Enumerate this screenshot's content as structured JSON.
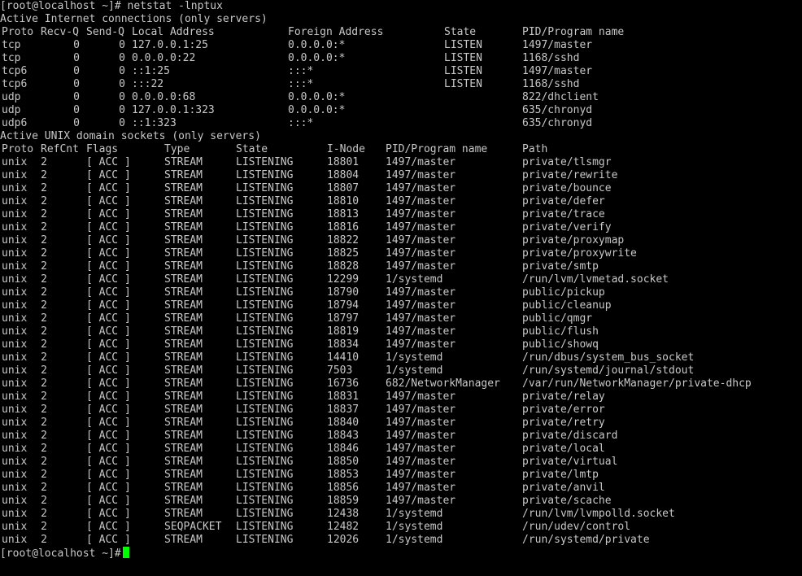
{
  "terminal": {
    "command_line": "[root@localhost ~]# netstat -lnptux",
    "inet_header": "Active Internet connections (only servers)",
    "inet_columns": [
      "Proto",
      "Recv-Q",
      "Send-Q",
      "Local Address",
      "Foreign Address",
      "State",
      "PID/Program name"
    ],
    "inet_rows": [
      [
        "tcp",
        "0",
        "0",
        "127.0.0.1:25",
        "0.0.0.0:*",
        "LISTEN",
        "1497/master"
      ],
      [
        "tcp",
        "0",
        "0",
        "0.0.0.0:22",
        "0.0.0.0:*",
        "LISTEN",
        "1168/sshd"
      ],
      [
        "tcp6",
        "0",
        "0",
        "::1:25",
        ":::*",
        "LISTEN",
        "1497/master"
      ],
      [
        "tcp6",
        "0",
        "0",
        ":::22",
        ":::*",
        "LISTEN",
        "1168/sshd"
      ],
      [
        "udp",
        "0",
        "0",
        "0.0.0.0:68",
        "0.0.0.0:*",
        "",
        "822/dhclient"
      ],
      [
        "udp",
        "0",
        "0",
        "127.0.0.1:323",
        "0.0.0.0:*",
        "",
        "635/chronyd"
      ],
      [
        "udp6",
        "0",
        "0",
        "::1:323",
        ":::*",
        "",
        "635/chronyd"
      ]
    ],
    "unix_header": "Active UNIX domain sockets (only servers)",
    "unix_columns": [
      "Proto",
      "RefCnt",
      "Flags",
      "Type",
      "State",
      "I-Node",
      "PID/Program name",
      "Path"
    ],
    "unix_rows": [
      [
        "unix",
        "2",
        "[ ACC ]",
        "STREAM",
        "LISTENING",
        "18801",
        "1497/master",
        "private/tlsmgr"
      ],
      [
        "unix",
        "2",
        "[ ACC ]",
        "STREAM",
        "LISTENING",
        "18804",
        "1497/master",
        "private/rewrite"
      ],
      [
        "unix",
        "2",
        "[ ACC ]",
        "STREAM",
        "LISTENING",
        "18807",
        "1497/master",
        "private/bounce"
      ],
      [
        "unix",
        "2",
        "[ ACC ]",
        "STREAM",
        "LISTENING",
        "18810",
        "1497/master",
        "private/defer"
      ],
      [
        "unix",
        "2",
        "[ ACC ]",
        "STREAM",
        "LISTENING",
        "18813",
        "1497/master",
        "private/trace"
      ],
      [
        "unix",
        "2",
        "[ ACC ]",
        "STREAM",
        "LISTENING",
        "18816",
        "1497/master",
        "private/verify"
      ],
      [
        "unix",
        "2",
        "[ ACC ]",
        "STREAM",
        "LISTENING",
        "18822",
        "1497/master",
        "private/proxymap"
      ],
      [
        "unix",
        "2",
        "[ ACC ]",
        "STREAM",
        "LISTENING",
        "18825",
        "1497/master",
        "private/proxywrite"
      ],
      [
        "unix",
        "2",
        "[ ACC ]",
        "STREAM",
        "LISTENING",
        "18828",
        "1497/master",
        "private/smtp"
      ],
      [
        "unix",
        "2",
        "[ ACC ]",
        "STREAM",
        "LISTENING",
        "12299",
        "1/systemd",
        "/run/lvm/lvmetad.socket"
      ],
      [
        "unix",
        "2",
        "[ ACC ]",
        "STREAM",
        "LISTENING",
        "18790",
        "1497/master",
        "public/pickup"
      ],
      [
        "unix",
        "2",
        "[ ACC ]",
        "STREAM",
        "LISTENING",
        "18794",
        "1497/master",
        "public/cleanup"
      ],
      [
        "unix",
        "2",
        "[ ACC ]",
        "STREAM",
        "LISTENING",
        "18797",
        "1497/master",
        "public/qmgr"
      ],
      [
        "unix",
        "2",
        "[ ACC ]",
        "STREAM",
        "LISTENING",
        "18819",
        "1497/master",
        "public/flush"
      ],
      [
        "unix",
        "2",
        "[ ACC ]",
        "STREAM",
        "LISTENING",
        "18834",
        "1497/master",
        "public/showq"
      ],
      [
        "unix",
        "2",
        "[ ACC ]",
        "STREAM",
        "LISTENING",
        "14410",
        "1/systemd",
        "/run/dbus/system_bus_socket"
      ],
      [
        "unix",
        "2",
        "[ ACC ]",
        "STREAM",
        "LISTENING",
        "7503",
        "1/systemd",
        "/run/systemd/journal/stdout"
      ],
      [
        "unix",
        "2",
        "[ ACC ]",
        "STREAM",
        "LISTENING",
        "16736",
        "682/NetworkManager",
        "/var/run/NetworkManager/private-dhcp"
      ],
      [
        "unix",
        "2",
        "[ ACC ]",
        "STREAM",
        "LISTENING",
        "18831",
        "1497/master",
        "private/relay"
      ],
      [
        "unix",
        "2",
        "[ ACC ]",
        "STREAM",
        "LISTENING",
        "18837",
        "1497/master",
        "private/error"
      ],
      [
        "unix",
        "2",
        "[ ACC ]",
        "STREAM",
        "LISTENING",
        "18840",
        "1497/master",
        "private/retry"
      ],
      [
        "unix",
        "2",
        "[ ACC ]",
        "STREAM",
        "LISTENING",
        "18843",
        "1497/master",
        "private/discard"
      ],
      [
        "unix",
        "2",
        "[ ACC ]",
        "STREAM",
        "LISTENING",
        "18846",
        "1497/master",
        "private/local"
      ],
      [
        "unix",
        "2",
        "[ ACC ]",
        "STREAM",
        "LISTENING",
        "18850",
        "1497/master",
        "private/virtual"
      ],
      [
        "unix",
        "2",
        "[ ACC ]",
        "STREAM",
        "LISTENING",
        "18853",
        "1497/master",
        "private/lmtp"
      ],
      [
        "unix",
        "2",
        "[ ACC ]",
        "STREAM",
        "LISTENING",
        "18856",
        "1497/master",
        "private/anvil"
      ],
      [
        "unix",
        "2",
        "[ ACC ]",
        "STREAM",
        "LISTENING",
        "18859",
        "1497/master",
        "private/scache"
      ],
      [
        "unix",
        "2",
        "[ ACC ]",
        "STREAM",
        "LISTENING",
        "12438",
        "1/systemd",
        "/run/lvm/lvmpolld.socket"
      ],
      [
        "unix",
        "2",
        "[ ACC ]",
        "SEQPACKET",
        "LISTENING",
        "12482",
        "1/systemd",
        "/run/udev/control"
      ],
      [
        "unix",
        "2",
        "[ ACC ]",
        "STREAM",
        "LISTENING",
        "12026",
        "1/systemd",
        "/run/systemd/private"
      ]
    ],
    "prompt": "[root@localhost ~]#",
    "colors": {
      "background": "#000000",
      "text": "#c8c8c8",
      "cursor": "#00ff00"
    }
  }
}
